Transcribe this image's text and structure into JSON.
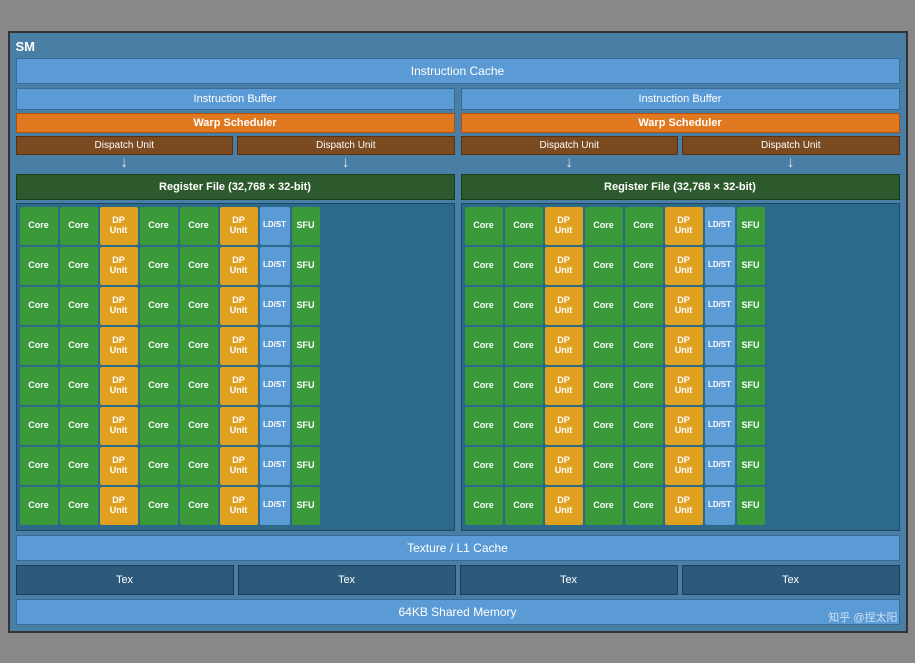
{
  "sm": {
    "label": "SM",
    "instruction_cache": "Instruction Cache",
    "left_half": {
      "instruction_buffer": "Instruction Buffer",
      "warp_scheduler": "Warp Scheduler",
      "dispatch_unit1": "Dispatch Unit",
      "dispatch_unit2": "Dispatch Unit",
      "register_file": "Register File (32,768 × 32-bit)"
    },
    "right_half": {
      "instruction_buffer": "Instruction Buffer",
      "warp_scheduler": "Warp Scheduler",
      "dispatch_unit1": "Dispatch Unit",
      "dispatch_unit2": "Dispatch Unit",
      "register_file": "Register File (32,768 × 32-bit)"
    },
    "texture_l1_cache": "Texture / L1 Cache",
    "tex_boxes": [
      "Tex",
      "Tex",
      "Tex",
      "Tex"
    ],
    "shared_memory": "64KB Shared Memory",
    "watermark": "知乎 @捏太阳",
    "core_rows": 8,
    "row_pattern": [
      "Core",
      "Core",
      "DP Unit",
      "Core",
      "Core",
      "DP Unit",
      "LD/ST",
      "SFU"
    ]
  }
}
